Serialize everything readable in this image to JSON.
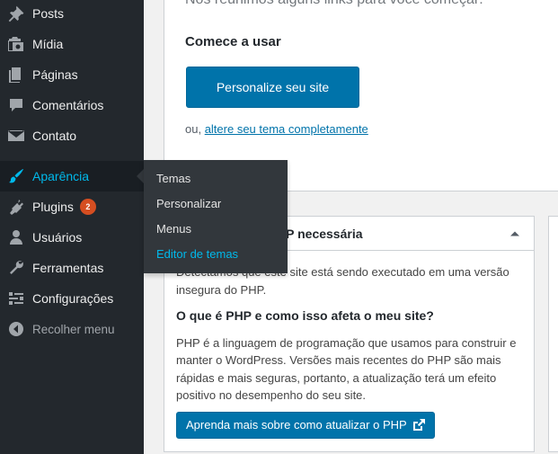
{
  "sidebar": {
    "items": [
      {
        "label": "Posts",
        "icon": "pushpin-icon"
      },
      {
        "label": "Mídia",
        "icon": "media-icon"
      },
      {
        "label": "Páginas",
        "icon": "pages-icon"
      },
      {
        "label": "Comentários",
        "icon": "comment-icon"
      },
      {
        "label": "Contato",
        "icon": "mail-icon"
      },
      {
        "label": "Aparência",
        "icon": "paintbrush-icon"
      },
      {
        "label": "Plugins",
        "icon": "plugin-icon",
        "badge": "2"
      },
      {
        "label": "Usuários",
        "icon": "user-icon"
      },
      {
        "label": "Ferramentas",
        "icon": "wrench-icon"
      },
      {
        "label": "Configurações",
        "icon": "settings-icon"
      },
      {
        "label": "Recolher menu",
        "icon": "collapse-icon"
      }
    ]
  },
  "flyout": {
    "items": [
      "Temas",
      "Personalizar",
      "Menus",
      "Editor de temas"
    ]
  },
  "welcome": {
    "tagline": "Nós reunimos alguns links para você começar:",
    "heading": "Comece a usar",
    "button": "Personalize seu site",
    "alt_prefix": "ou, ",
    "alt_link": "altere seu tema completamente"
  },
  "php_box": {
    "title": "Atualização do PHP necessária",
    "intro": "Detectamos que este site está sendo executado em uma versão insegura do PHP.",
    "question": "O que é PHP e como isso afeta o meu site?",
    "description": "PHP é a linguagem de programação que usamos para construir e manter o WordPress. Versões mais recentes do PHP são mais rápidas e mais seguras, portanto, a atualização terá um efeito positivo no desempenho do seu site.",
    "button": "Aprenda mais sobre como atualizar o PHP"
  },
  "colors": {
    "sidebar_bg": "#23282d",
    "flyout_bg": "#32373c",
    "accent": "#00b9eb",
    "primary_button": "#0073aa",
    "badge": "#d54e21"
  }
}
